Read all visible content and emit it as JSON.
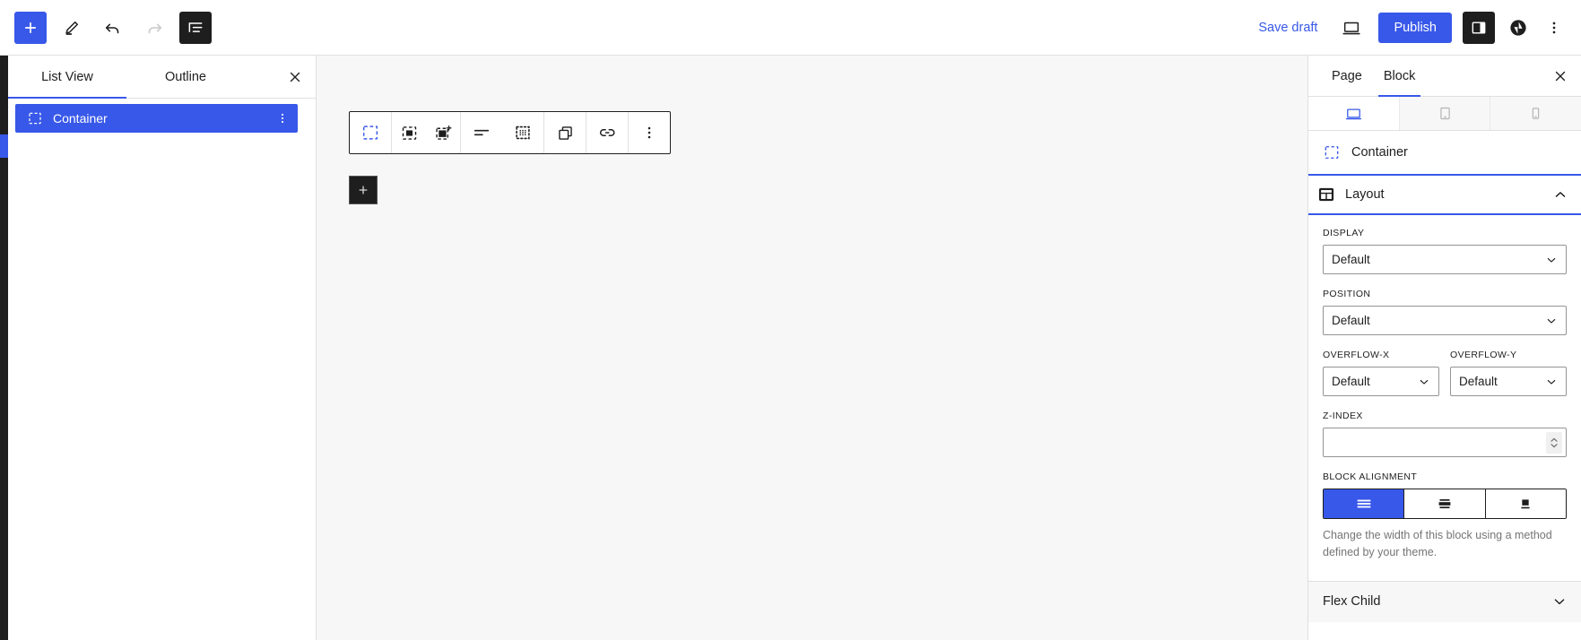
{
  "topbar": {
    "add_block_label": "+",
    "tools": [
      {
        "name": "add-block-button",
        "icon": "plus-icon",
        "title": "Toggle block inserter"
      },
      {
        "name": "edit-tool-button",
        "icon": "pencil-icon",
        "title": "Tools"
      },
      {
        "name": "undo-button",
        "icon": "undo-icon",
        "title": "Undo"
      },
      {
        "name": "redo-button",
        "icon": "redo-icon",
        "title": "Redo"
      },
      {
        "name": "list-view-button",
        "icon": "list-view-icon",
        "title": "Document Overview"
      }
    ],
    "save_draft_label": "Save draft",
    "preview_label": "View",
    "publish_label": "Publish",
    "settings_label": "Settings",
    "plugin_label": "Plugin",
    "options_label": "Options"
  },
  "list_view": {
    "tabs": [
      {
        "label": "List View",
        "active": true
      },
      {
        "label": "Outline",
        "active": false
      }
    ],
    "close_label": "Close",
    "items": [
      {
        "label": "Container",
        "icon": "container-icon",
        "selected": true
      }
    ]
  },
  "block_toolbar": {
    "buttons": [
      {
        "name": "block-type-container",
        "icon": "container-icon"
      },
      {
        "name": "select-parent-block",
        "icon": "select-parent-icon"
      },
      {
        "name": "add-child-block",
        "icon": "add-child-icon"
      },
      {
        "name": "align-button",
        "icon": "align-icon"
      },
      {
        "name": "drag-handle",
        "icon": "drag-dots-icon"
      },
      {
        "name": "duplicate-button",
        "icon": "copy-icon"
      },
      {
        "name": "link-button",
        "icon": "link-icon"
      },
      {
        "name": "more-options-button",
        "icon": "vertical-dots-icon"
      }
    ]
  },
  "canvas": {
    "appender_label": "+"
  },
  "sidebar": {
    "tabs": [
      {
        "label": "Page",
        "active": false
      },
      {
        "label": "Block",
        "active": true
      }
    ],
    "close_label": "Close settings",
    "device_tabs": [
      {
        "name": "desktop",
        "icon": "desktop-icon",
        "active": true
      },
      {
        "name": "tablet",
        "icon": "tablet-icon",
        "active": false
      },
      {
        "name": "mobile",
        "icon": "mobile-icon",
        "active": false
      }
    ],
    "block_name": "Container",
    "block_icon": "container-icon",
    "panel": {
      "title": "Layout",
      "icon": "layout-icon",
      "expanded": true,
      "chevron": "chevron-up-icon"
    },
    "fields": {
      "display": {
        "label": "DISPLAY",
        "value": "Default"
      },
      "position": {
        "label": "POSITION",
        "value": "Default"
      },
      "overflow_x": {
        "label": "OVERFLOW-X",
        "value": "Default"
      },
      "overflow_y": {
        "label": "OVERFLOW-Y",
        "value": "Default"
      },
      "z_index": {
        "label": "Z-INDEX",
        "value": "",
        "placeholder": ""
      },
      "block_alignment": {
        "label": "BLOCK ALIGNMENT",
        "options": [
          {
            "name": "align-full",
            "icon": "align-full-icon",
            "active": true
          },
          {
            "name": "align-wide",
            "icon": "align-wide-icon",
            "active": false
          },
          {
            "name": "align-default",
            "icon": "align-default-icon",
            "active": false
          }
        ],
        "help": "Change the width of this block using a method defined by your theme."
      }
    },
    "next_panel": {
      "title": "Flex Child",
      "chevron": "chevron-down-icon"
    }
  },
  "colors": {
    "accent": "#3858e9",
    "dark": "#1e1e1e",
    "canvas_bg": "#f7f7f7",
    "border": "#e0e0e0"
  }
}
